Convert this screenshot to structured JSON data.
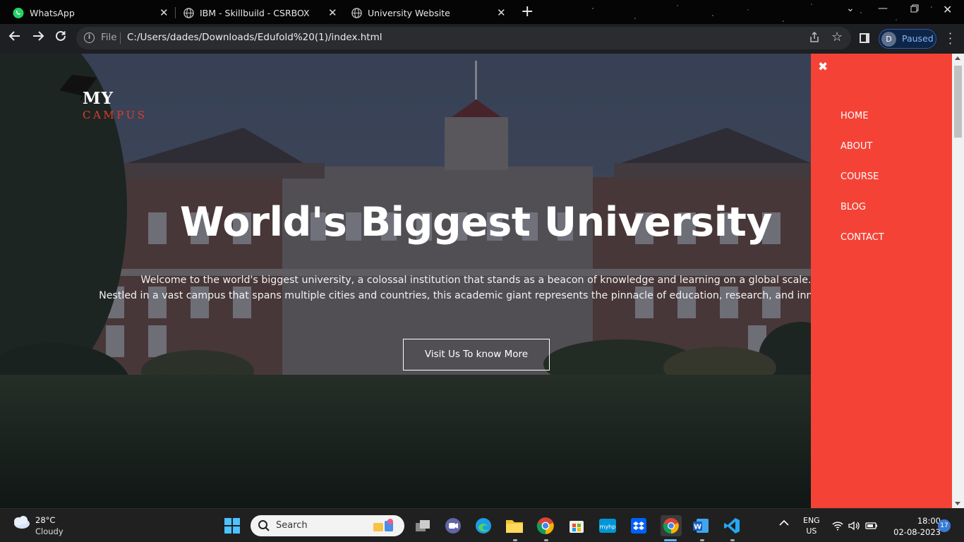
{
  "browser": {
    "tabs": [
      {
        "title": "WhatsApp",
        "icon": "whatsapp-icon",
        "close": "✕"
      },
      {
        "title": "IBM - Skillbuild - CSRBOX",
        "icon": "globe-icon",
        "close": "✕"
      },
      {
        "title": "University Website",
        "icon": "globe-icon",
        "close": "✕"
      }
    ],
    "new_tab": "+",
    "address_bar": {
      "scheme_label": "File",
      "url": "C:/Users/dades/Downloads/Edufold%20(1)/index.html"
    },
    "profile": {
      "initial": "D",
      "status": "Paused"
    }
  },
  "page": {
    "logo": {
      "line1": "MY",
      "line2": "CAMPUS"
    },
    "hero": {
      "title": "World's Biggest University",
      "paragraph_line1": "Welcome to the world's biggest university, a colossal institution that stands as a beacon of knowledge and learning on a global scale.",
      "paragraph_line2": "Nestled in a vast campus that spans multiple cities and countries, this academic giant represents the pinnacle of education, research, and innovation.",
      "button": "Visit Us To know More"
    },
    "side_nav": {
      "close_icon": "✖",
      "items": [
        "HOME",
        "ABOUT",
        "COURSE",
        "BLOG",
        "CONTACT"
      ],
      "background": "#f44336"
    }
  },
  "taskbar": {
    "weather": {
      "temp": "28°C",
      "condition": "Cloudy"
    },
    "search_label": "Search",
    "language": {
      "line1": "ENG",
      "line2": "US"
    },
    "clock": {
      "time": "18:00",
      "date": "02-08-2023"
    },
    "notifications": "17"
  }
}
